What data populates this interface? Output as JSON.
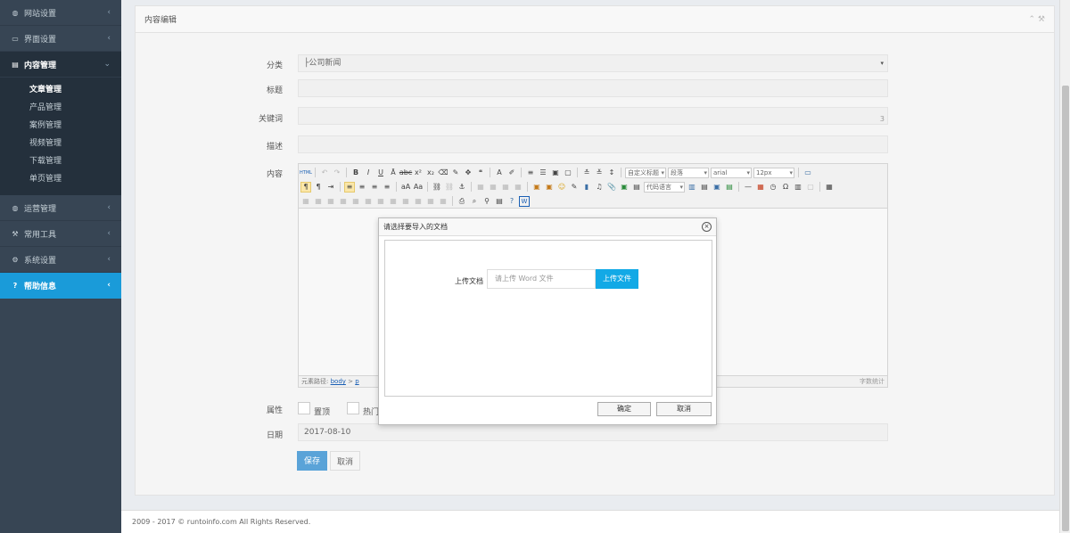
{
  "sidebar": {
    "items": [
      {
        "label": "网站设置",
        "icon": "globe-icon",
        "chevron": "‹"
      },
      {
        "label": "界面设置",
        "icon": "monitor-icon",
        "chevron": "‹"
      },
      {
        "label": "内容管理",
        "icon": "list-icon",
        "chevron": "⌄"
      },
      {
        "label": "运营管理",
        "icon": "gauge-icon",
        "chevron": "‹"
      },
      {
        "label": "常用工具",
        "icon": "wrench-icon",
        "chevron": "‹"
      },
      {
        "label": "系统设置",
        "icon": "cogs-icon",
        "chevron": "‹"
      },
      {
        "label": "帮助信息",
        "icon": "question-icon",
        "chevron": "‹"
      }
    ],
    "subitems": [
      "文章管理",
      "产品管理",
      "案例管理",
      "视频管理",
      "下载管理",
      "单页管理"
    ]
  },
  "panel": {
    "title": "内容编辑",
    "tools": "⌃ ⚒"
  },
  "form": {
    "category_label": "分类",
    "category_value": "├公司新闻",
    "title_label": "标题",
    "keywords_label": "关键词",
    "keywords_count": "3",
    "desc_label": "描述",
    "content_label": "内容",
    "attr_label": "属性",
    "attr_top": "置顶",
    "attr_hot": "热门",
    "date_label": "日期",
    "date_value": "2017-08-10",
    "save": "保存",
    "cancel": "取消"
  },
  "editor": {
    "custom_title": "自定义标题",
    "paragraph": "段落",
    "font": "arial",
    "size": "12px",
    "code_lang": "代码语言",
    "path_label": "元素路径:",
    "path_body": "body",
    "path_sep": ">",
    "path_p": "p",
    "word_count": "字数统计"
  },
  "modal": {
    "title": "请选择要导入的文档",
    "close": "×",
    "upload_label": "上传文档",
    "upload_placeholder": "请上传 Word 文件",
    "upload_button": "上传文件",
    "ok": "确定",
    "cancel": "取消"
  },
  "footer": {
    "copyright": "2009 - 2017 © runtoinfo.com All Rights Reserved."
  }
}
